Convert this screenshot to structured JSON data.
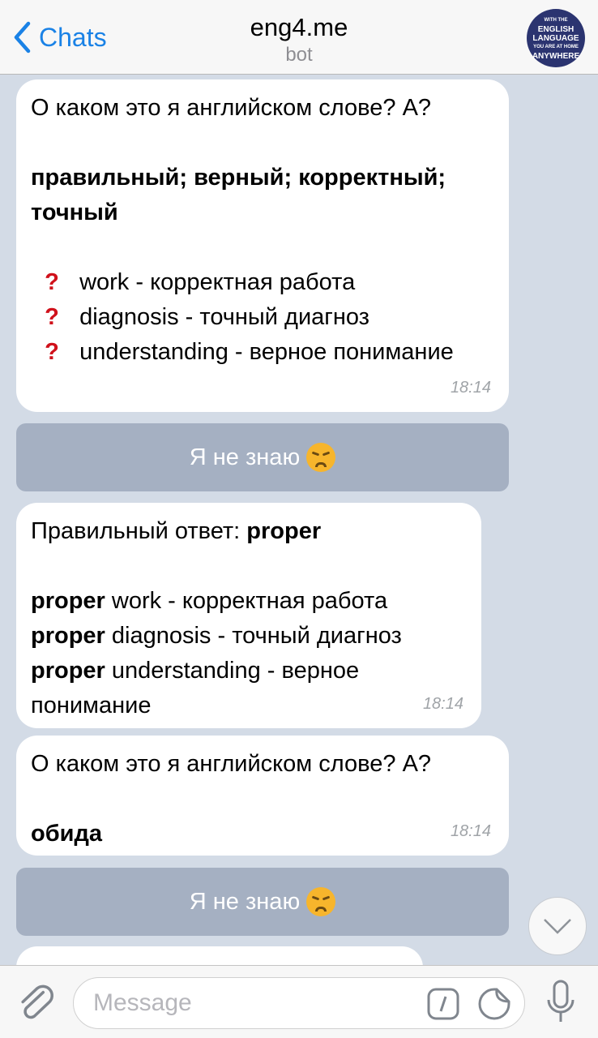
{
  "header": {
    "back_label": "Chats",
    "title": "eng4.me",
    "subtitle": "bot",
    "avatar_text": [
      "WITH THE",
      "ENGLISH",
      "LANGUAGE",
      "YOU ARE AT HOME",
      "ANYWHERE"
    ]
  },
  "messages": [
    {
      "question": "О каком это я английском слове? A?",
      "definition": "правильный; верный; корректный; точный",
      "items": [
        "work - корректная работа",
        "diagnosis - точный диагноз",
        "understanding - верное понимание"
      ],
      "time": "18:14"
    },
    {
      "answer_prefix": "Правильный ответ: ",
      "answer": "proper",
      "examples": [
        {
          "word": "proper",
          "rest": " work - корректная работа"
        },
        {
          "word": "proper",
          "rest": " diagnosis - точный диагноз"
        },
        {
          "word": "proper",
          "rest": " understanding - верное понимание"
        }
      ],
      "time": "18:14"
    },
    {
      "question": "О каком это я английском слове? A?",
      "definition": "обида",
      "time": "18:14"
    }
  ],
  "keyboard_button": "Я не знаю",
  "input": {
    "placeholder": "Message"
  },
  "colors": {
    "accent": "#1a82e6",
    "question_mark": "#d0111b"
  }
}
